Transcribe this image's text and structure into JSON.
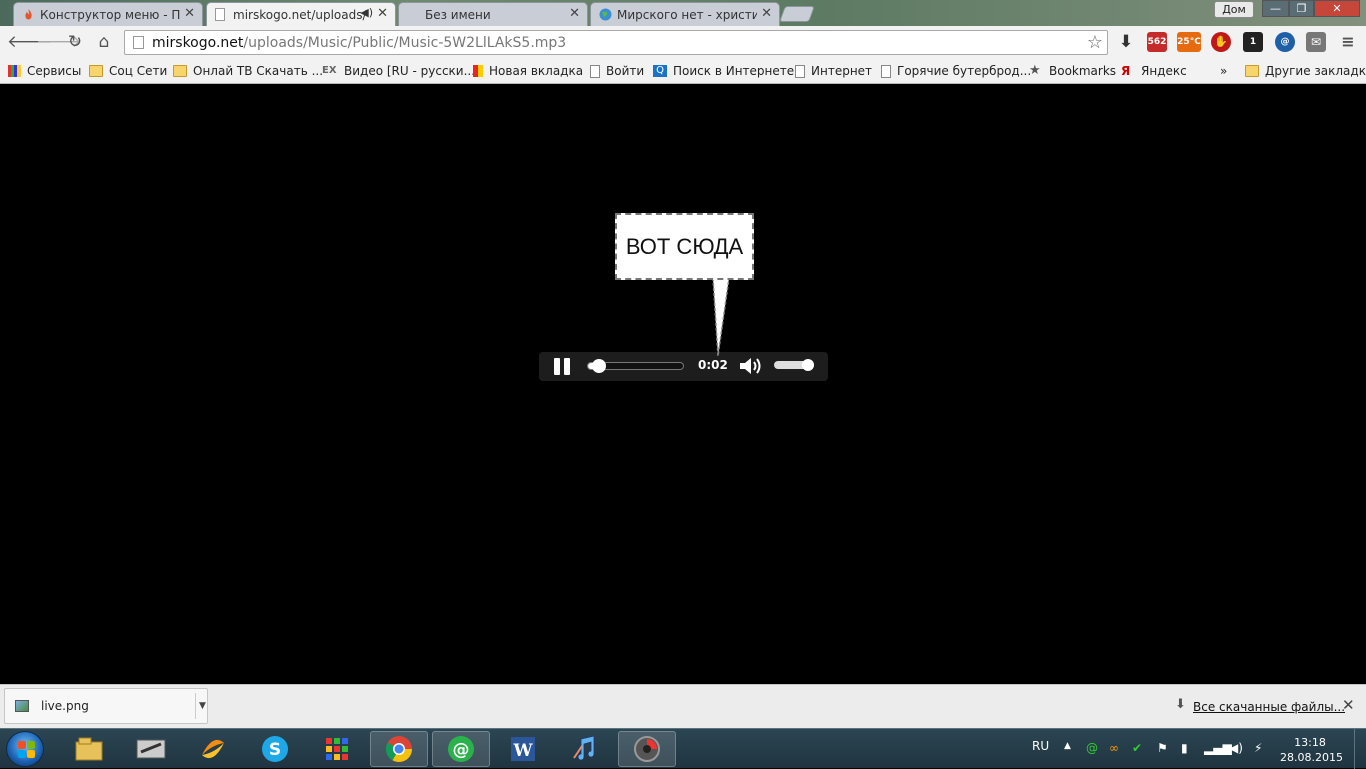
{
  "tabs": [
    {
      "title": "Конструктор меню - Пан",
      "favicon": "flame-icon",
      "active": false
    },
    {
      "title": "mirskogo.net/uploads/",
      "favicon": "page-icon",
      "active": true,
      "audio": true
    },
    {
      "title": "Без имени",
      "favicon": "none",
      "active": false
    },
    {
      "title": "Мирского нет - христиан",
      "favicon": "globe-icon",
      "active": false
    }
  ],
  "window": {
    "profile": "Дом",
    "min": "—",
    "max": "❐",
    "close": "✕"
  },
  "omnibox": {
    "domain": "mirskogo.net",
    "path": "/uploads/Music/Public/Music-5W2LlLAkS5.mp3"
  },
  "extensions": {
    "badge1": "562",
    "weather": "25°C",
    "badge2": "1"
  },
  "bookmarks": [
    {
      "label": "Сервисы",
      "icon": "apps-icon"
    },
    {
      "label": "Соц Сети",
      "icon": "folder-icon"
    },
    {
      "label": "Онлай ТВ Скачать ...",
      "icon": "folder-icon"
    },
    {
      "label": "Видео [RU - русски...",
      "icon": "ex-icon"
    },
    {
      "label": "Новая вкладка",
      "icon": "flag-icon"
    },
    {
      "label": "Войти",
      "icon": "page-icon"
    },
    {
      "label": "Поиск в Интернете",
      "icon": "search-icon"
    },
    {
      "label": "Интернет",
      "icon": "page-icon"
    },
    {
      "label": "Горячие бутерброд...",
      "icon": "page-icon"
    },
    {
      "label": "Bookmarks",
      "icon": "star-icon"
    },
    {
      "label": "Яндекс",
      "icon": "yandex-icon"
    }
  ],
  "bookmarks_more": "»",
  "other_bookmarks": "Другие закладки",
  "player": {
    "time": "0:02",
    "progress": 0.08,
    "volume": 0.85
  },
  "callout": {
    "text": "ВОТ СЮДА"
  },
  "download": {
    "filename": "live.png",
    "show_all": "Все скачанные файлы...",
    "close": "✕"
  },
  "taskbar": {
    "apps": [
      "explorer-icon",
      "scanner-icon",
      "fan-icon",
      "skype-icon",
      "apps-grid-icon",
      "chrome-icon",
      "mail-agent-icon",
      "word-icon",
      "music-icon",
      "record-icon"
    ],
    "lang": "RU",
    "time": "13:18",
    "date": "28.08.2015"
  }
}
